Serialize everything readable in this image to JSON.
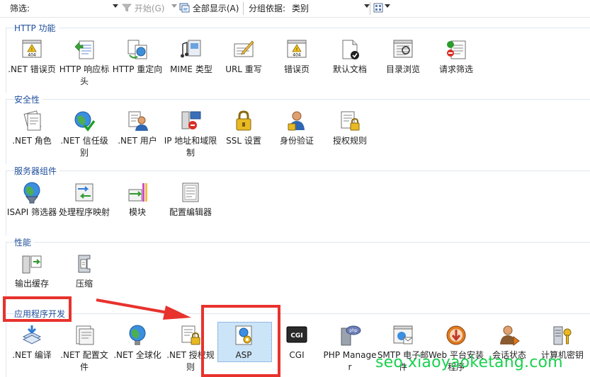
{
  "toolbar": {
    "filter_label": "筛选:",
    "start_label": "开始(G)",
    "show_all_label": "全部显示(A)",
    "group_by_label": "分组依据:",
    "group_by_value": "类别"
  },
  "sections": {
    "http": {
      "title": "HTTP 功能",
      "items": [
        {
          "label": ".NET 错误页",
          "icon": "error-page-404-icon"
        },
        {
          "label": "HTTP 响应标头",
          "icon": "http-response-headers-icon"
        },
        {
          "label": "HTTP 重定向",
          "icon": "http-redirect-icon"
        },
        {
          "label": "MIME 类型",
          "icon": "mime-types-icon"
        },
        {
          "label": "URL 重写",
          "icon": "url-rewrite-icon"
        },
        {
          "label": "错误页",
          "icon": "error-pages-icon"
        },
        {
          "label": "默认文档",
          "icon": "default-document-icon"
        },
        {
          "label": "目录浏览",
          "icon": "directory-browsing-icon"
        },
        {
          "label": "请求筛选",
          "icon": "request-filtering-icon"
        }
      ]
    },
    "security": {
      "title": "安全性",
      "items": [
        {
          "label": ".NET 角色",
          "icon": "net-roles-icon"
        },
        {
          "label": ".NET 信任级别",
          "icon": "net-trust-levels-icon"
        },
        {
          "label": ".NET 用户",
          "icon": "net-users-icon"
        },
        {
          "label": "IP 地址和域限制",
          "icon": "ip-domain-restrictions-icon"
        },
        {
          "label": "SSL 设置",
          "icon": "ssl-settings-icon"
        },
        {
          "label": "身份验证",
          "icon": "authentication-icon"
        },
        {
          "label": "授权规则",
          "icon": "authorization-rules-icon"
        }
      ]
    },
    "server": {
      "title": "服务器组件",
      "items": [
        {
          "label": "ISAPI 筛选器",
          "icon": "isapi-filters-icon"
        },
        {
          "label": "处理程序映射",
          "icon": "handler-mappings-icon"
        },
        {
          "label": "模块",
          "icon": "modules-icon"
        },
        {
          "label": "配置编辑器",
          "icon": "configuration-editor-icon"
        }
      ]
    },
    "performance": {
      "title": "性能",
      "items": [
        {
          "label": "输出缓存",
          "icon": "output-caching-icon"
        },
        {
          "label": "压缩",
          "icon": "compression-icon"
        }
      ]
    },
    "appdev": {
      "title": "应用程序开发",
      "items": [
        {
          "label": ".NET 编译",
          "icon": "net-compilation-icon"
        },
        {
          "label": ".NET 配置文件",
          "icon": "net-profile-icon"
        },
        {
          "label": ".NET 全球化",
          "icon": "net-globalization-icon"
        },
        {
          "label": ".NET 授权规则",
          "icon": "net-authorization-rules-icon"
        },
        {
          "label": "ASP",
          "icon": "asp-icon"
        },
        {
          "label": "CGI",
          "icon": "cgi-icon"
        },
        {
          "label": "PHP Manager",
          "icon": "php-manager-icon"
        },
        {
          "label": "SMTP 电子邮件",
          "icon": "smtp-email-icon"
        },
        {
          "label": "Web 平台安装程序",
          "icon": "web-platform-installer-icon"
        },
        {
          "label": "会话状态",
          "icon": "session-state-icon"
        },
        {
          "label": "计算机密钥",
          "icon": "machine-key-icon"
        }
      ]
    }
  },
  "watermark": "seo.xiaoyaoketang.com",
  "colors": {
    "section_title": "#1f4e9a",
    "highlight_red": "#e8322d",
    "selection": "#cce4f7",
    "watermark": "#19d14e"
  }
}
